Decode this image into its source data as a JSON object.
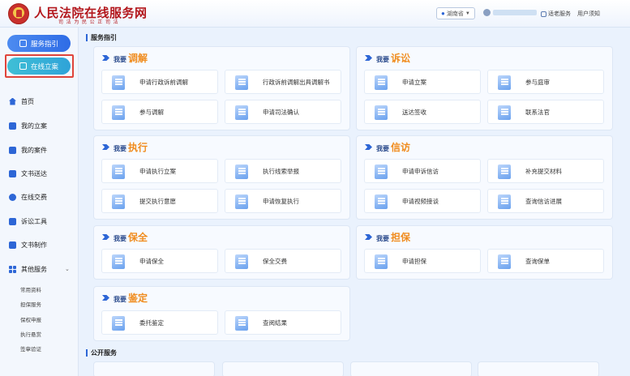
{
  "header": {
    "site_title": "人民法院在线服务网",
    "slogan": "司 法 为 民   公 正 司 法",
    "region": "湖南省",
    "elder_mode": "适老服务",
    "user_notice": "用户须知"
  },
  "sidebar": {
    "service_guide": "服务指引",
    "online_filing": "在线立案",
    "items": [
      {
        "label": "首页"
      },
      {
        "label": "我的立案"
      },
      {
        "label": "我的案件"
      },
      {
        "label": "文书送达"
      },
      {
        "label": "在线交费"
      },
      {
        "label": "诉讼工具"
      },
      {
        "label": "文书制作"
      },
      {
        "label": "其他服务"
      }
    ],
    "sub_items": [
      "常用资料",
      "担保服务",
      "保权申报",
      "执行悬赏",
      "签章验证"
    ]
  },
  "main": {
    "section_title": "服务指引",
    "public_title": "公开服务",
    "cards": {
      "mediation": {
        "pre": "我要",
        "title": "调解",
        "items": [
          "申请行政诉前调解",
          "行政诉前调解出具调解书",
          "参与调解",
          "申请司法确认"
        ]
      },
      "litigation": {
        "pre": "我要",
        "title": "诉讼",
        "items": [
          "申请立案",
          "参与庭审",
          "送达签收",
          "联系法官"
        ]
      },
      "execution": {
        "pre": "我要",
        "title": "执行",
        "items": [
          "申请执行立案",
          "执行线索举报",
          "提交执行意愿",
          "申请恢复执行"
        ]
      },
      "petition": {
        "pre": "我要",
        "title": "信访",
        "items": [
          "申请申诉信访",
          "补充提交材料",
          "申请视频接谈",
          "查询信访进展"
        ]
      },
      "preservation": {
        "pre": "我要",
        "title": "保全",
        "items": [
          "申请保全",
          "保全交费"
        ]
      },
      "guarantee": {
        "pre": "我要",
        "title": "担保",
        "items": [
          "申请担保",
          "查询保单"
        ]
      },
      "appraisal": {
        "pre": "我要",
        "title": "鉴定",
        "items": [
          "委托鉴定",
          "查阅结果"
        ]
      }
    }
  },
  "colors": {
    "accent": "#2d66d6",
    "highlight": "#f08c1e",
    "frame": "#e0443b",
    "brand_red": "#b3171c"
  }
}
